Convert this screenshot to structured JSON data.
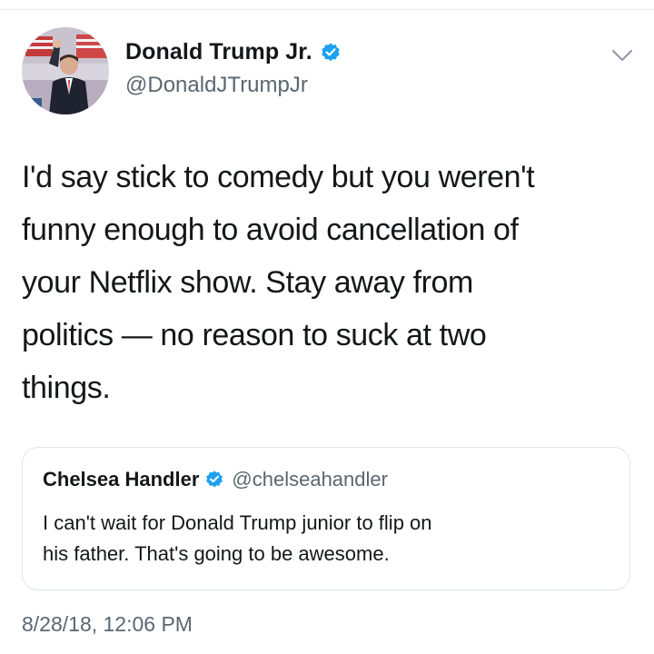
{
  "tweet": {
    "author": {
      "display_name": "Donald Trump Jr.",
      "handle": "@DonaldJTrumpJr",
      "verified_icon": "verified-badge-icon"
    },
    "text": "I'd say stick to comedy but you weren't\nfunny enough to avoid cancellation of\nyour Netflix show. Stay away from\npolitics — no reason to suck at two\nthings.",
    "menu_icon": "chevron-down-icon",
    "timestamp": "8/28/18, 12:06 PM"
  },
  "quoted_tweet": {
    "author": {
      "display_name": "Chelsea Handler",
      "handle": "@chelseahandler",
      "verified_icon": "verified-badge-icon"
    },
    "text": "I can't wait for Donald Trump junior to flip on\nhis father. That's going to be awesome."
  },
  "colors": {
    "verified_blue": "#1da1f2",
    "secondary_text": "#5b6670",
    "primary_text": "#14171a",
    "border": "#dfe4e8"
  }
}
